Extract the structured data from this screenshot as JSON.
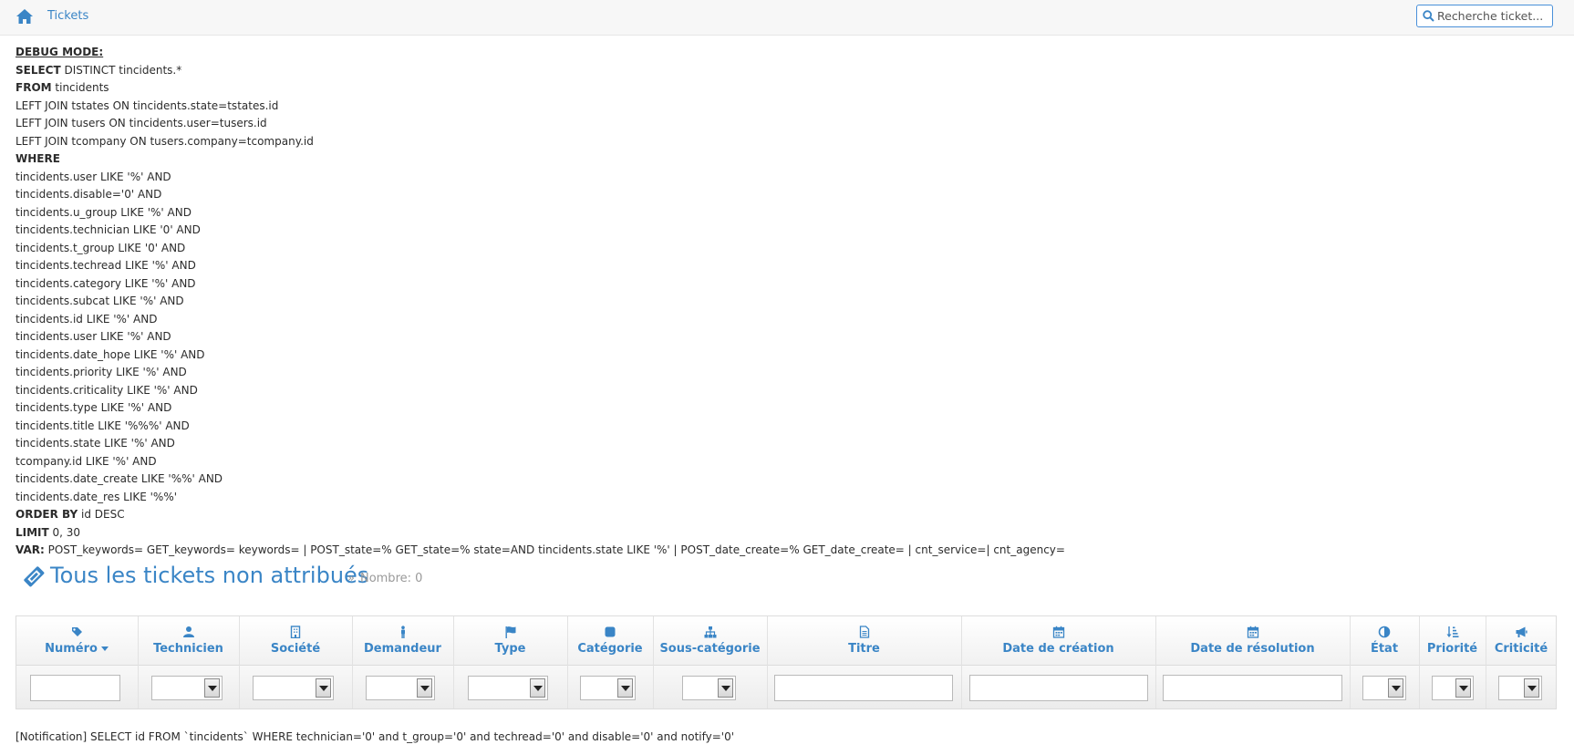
{
  "navbar": {
    "home_icon": "home-icon",
    "link_label": "Tickets",
    "search_placeholder": "Recherche ticket..."
  },
  "debug": {
    "header": "DEBUG MODE:",
    "lines": [
      {
        "kw": "SELECT",
        "text": " DISTINCT tincidents.*"
      },
      {
        "kw": "FROM",
        "text": " tincidents"
      },
      {
        "kw": "",
        "text": "LEFT JOIN tstates ON tincidents.state=tstates.id"
      },
      {
        "kw": "",
        "text": "LEFT JOIN tusers ON tincidents.user=tusers.id"
      },
      {
        "kw": "",
        "text": "LEFT JOIN tcompany ON tusers.company=tcompany.id"
      },
      {
        "kw": "WHERE",
        "text": ""
      },
      {
        "kw": "",
        "text": "tincidents.user LIKE '%' AND"
      },
      {
        "kw": "",
        "text": "tincidents.disable='0' AND"
      },
      {
        "kw": "",
        "text": "tincidents.u_group LIKE '%' AND"
      },
      {
        "kw": "",
        "text": "tincidents.technician LIKE '0' AND"
      },
      {
        "kw": "",
        "text": "tincidents.t_group LIKE '0' AND"
      },
      {
        "kw": "",
        "text": "tincidents.techread LIKE '%' AND"
      },
      {
        "kw": "",
        "text": "tincidents.category LIKE '%' AND"
      },
      {
        "kw": "",
        "text": "tincidents.subcat LIKE '%' AND"
      },
      {
        "kw": "",
        "text": "tincidents.id LIKE '%' AND"
      },
      {
        "kw": "",
        "text": "tincidents.user LIKE '%' AND"
      },
      {
        "kw": "",
        "text": "tincidents.date_hope LIKE '%' AND"
      },
      {
        "kw": "",
        "text": "tincidents.priority LIKE '%' AND"
      },
      {
        "kw": "",
        "text": "tincidents.criticality LIKE '%' AND"
      },
      {
        "kw": "",
        "text": "tincidents.type LIKE '%' AND"
      },
      {
        "kw": "",
        "text": "tincidents.title LIKE '%%%' AND"
      },
      {
        "kw": "",
        "text": "tincidents.state LIKE '%' AND"
      },
      {
        "kw": "",
        "text": "tcompany.id LIKE '%' AND"
      },
      {
        "kw": "",
        "text": "tincidents.date_create LIKE '%%' AND"
      },
      {
        "kw": "",
        "text": "tincidents.date_res LIKE '%%'"
      },
      {
        "kw": "ORDER BY",
        "text": " id DESC"
      },
      {
        "kw": "LIMIT",
        "text": " 0, 30"
      },
      {
        "kw": "VAR:",
        "text": " POST_keywords= GET_keywords= keywords= | POST_state=% GET_state=% state=AND tincidents.state LIKE '%' | POST_date_create=% GET_date_create= | cnt_service=| cnt_agency="
      }
    ]
  },
  "page": {
    "title": "Tous les tickets non attribués",
    "count_label": "Nombre: 0",
    "title_icon": "tickets-icon"
  },
  "table": {
    "columns": [
      {
        "label": "Numéro",
        "icon": "tag-icon",
        "sorted": "desc",
        "filter": "text"
      },
      {
        "label": "Technicien",
        "icon": "user-icon",
        "filter": "select"
      },
      {
        "label": "Société",
        "icon": "building-icon",
        "filter": "select"
      },
      {
        "label": "Demandeur",
        "icon": "male-icon",
        "filter": "select"
      },
      {
        "label": "Type",
        "icon": "flag-icon",
        "filter": "select"
      },
      {
        "label": "Catégorie",
        "icon": "square-icon",
        "filter": "select"
      },
      {
        "label": "Sous-catégorie",
        "icon": "sitemap-icon",
        "filter": "select"
      },
      {
        "label": "Titre",
        "icon": "file-icon",
        "filter": "text"
      },
      {
        "label": "Date de création",
        "icon": "calendar-icon",
        "filter": "text"
      },
      {
        "label": "Date de résolution",
        "icon": "calendar-icon",
        "filter": "text"
      },
      {
        "label": "État",
        "icon": "adjust-icon",
        "filter": "select"
      },
      {
        "label": "Priorité",
        "icon": "sort-amount-icon",
        "filter": "select"
      },
      {
        "label": "Criticité",
        "icon": "bullhorn-icon",
        "filter": "select"
      }
    ]
  },
  "notification": "[Notification] SELECT id FROM `tincidents` WHERE technician='0' and t_group='0' and techread='0' and disable='0' and notify='0'",
  "colors": {
    "accent": "#3a85c6",
    "text": "#2b2b2b",
    "muted": "#999999"
  }
}
